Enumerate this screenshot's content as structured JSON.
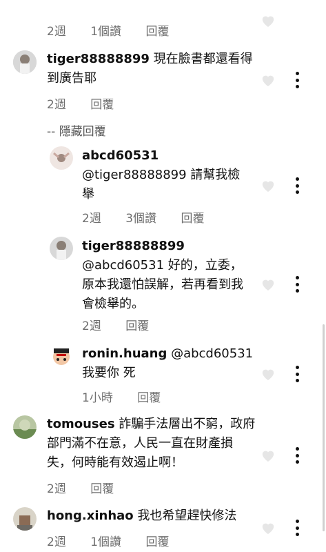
{
  "top_meta": {
    "time": "2週",
    "likes": "1個讚",
    "reply": "回覆"
  },
  "comments": [
    {
      "user": "tiger88888899",
      "text_line1": " 現在臉書都還看得",
      "text_line2": "到廣告耶",
      "time": "2週",
      "reply": "回覆"
    },
    {
      "hide_label": "-- 隱藏回覆"
    },
    {
      "user": "abcd60531",
      "text_line1": "@tiger88888899 請幫我檢",
      "text_line2": "舉",
      "time": "2週",
      "likes": "3個讚",
      "reply": "回覆"
    },
    {
      "user": "tiger88888899",
      "text_line1": "@abcd60531 好的，立委，",
      "text_line2": "原本我還怕誤解，若再看到我",
      "text_line3": "會檢舉的。",
      "time": "2週",
      "reply": "回覆"
    },
    {
      "user": "ronin.huang",
      "text_line1": " @abcd60531",
      "text_line2": "我要你 死",
      "time": "1小時",
      "reply": "回覆"
    },
    {
      "user": "tomouses",
      "text_line1": " 詐騙手法層出不窮，政府",
      "text_line2": "部門滿不在意，人民一直在財產損",
      "text_line3": "失，何時能有效遏止啊！",
      "time": "2週",
      "reply": "回覆"
    },
    {
      "user": "hong.xinhao",
      "text_line1": " 我也希望趕快修法",
      "time": "2週",
      "likes": "1個讚",
      "reply": "回覆"
    }
  ],
  "colors": {
    "text": "#111111",
    "meta": "#6f6f6f",
    "heart": "#e6e6e6"
  },
  "icons": [
    "heart-icon",
    "more-options-icon",
    "avatar"
  ]
}
